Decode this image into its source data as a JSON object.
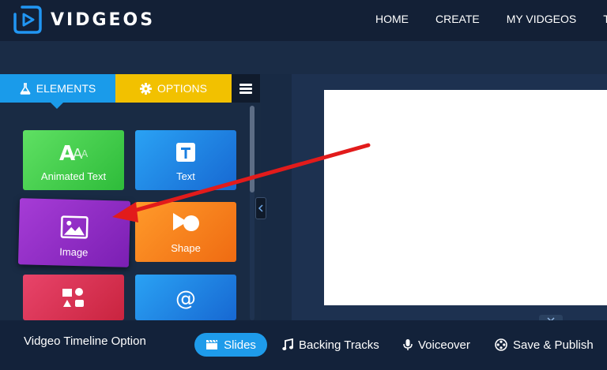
{
  "app": {
    "brand": "VIDGEOS",
    "nav": [
      "HOME",
      "CREATE",
      "MY VIDGEOS",
      "TU"
    ]
  },
  "panel": {
    "tabs": {
      "elements": "ELEMENTS",
      "options": "OPTIONS"
    },
    "tiles": [
      {
        "label": "Animated Text",
        "icon": "animated-text-icon"
      },
      {
        "label": "Text",
        "icon": "text-icon"
      },
      {
        "label": "Image",
        "icon": "image-icon"
      },
      {
        "label": "Shape",
        "icon": "shape-icon"
      },
      {
        "label": "",
        "icon": "media-icon"
      },
      {
        "label": "",
        "icon": "at-sign-icon"
      }
    ]
  },
  "bottom": {
    "title": "Vidgeo Timeline Option",
    "slides": "Slides",
    "tracks": "Backing Tracks",
    "voice": "Voiceover",
    "save": "Save & Publish"
  },
  "colors": {
    "elements_tab": "#1a9bea",
    "options_tab": "#f2c100",
    "image_tile": "#8a2bc2",
    "annotation_arrow": "#e21b1b"
  }
}
